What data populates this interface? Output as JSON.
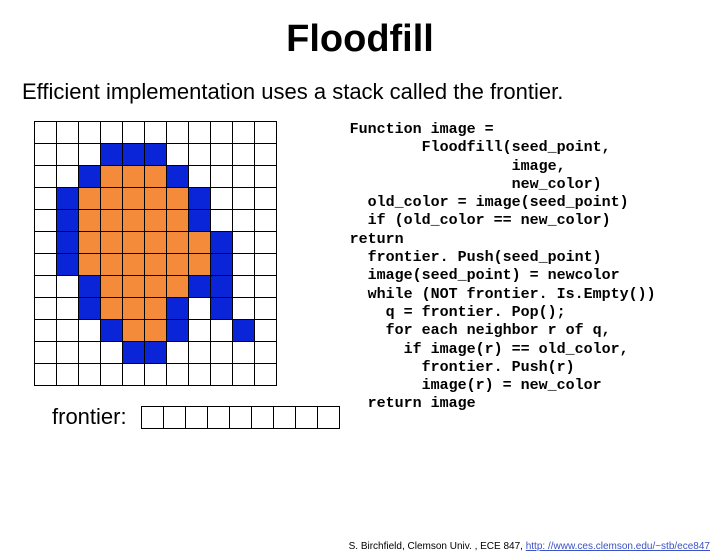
{
  "title": "Floodfill",
  "subtitle": "Efficient implementation uses a stack called the frontier.",
  "frontier_label": "frontier:",
  "code": {
    "l1": "Function image =",
    "l2": "        Floodfill(seed_point,",
    "l3": "                  image,",
    "l4": "                  new_color)",
    "l5": "  old_color = image(seed_point)",
    "l6": "  if (old_color == new_color)",
    "l7": "return",
    "l8": "  frontier. Push(seed_point)",
    "l9": "  image(seed_point) = newcolor",
    "l10": "  while (NOT frontier. Is.Empty())",
    "l11": "    q = frontier. Pop();",
    "l12": "    for each neighbor r of q,",
    "l13": "      if image(r) == old_color,",
    "l14": "        frontier. Push(r)",
    "l15": "        image(r) = new_color",
    "l16": "  return image"
  },
  "grid": [
    [
      "w",
      "w",
      "w",
      "w",
      "w",
      "w",
      "w",
      "w",
      "w",
      "w",
      "w"
    ],
    [
      "w",
      "w",
      "w",
      "b",
      "b",
      "b",
      "w",
      "w",
      "w",
      "w",
      "w"
    ],
    [
      "w",
      "w",
      "b",
      "o",
      "o",
      "o",
      "b",
      "w",
      "w",
      "w",
      "w"
    ],
    [
      "w",
      "b",
      "o",
      "o",
      "o",
      "o",
      "o",
      "b",
      "w",
      "w",
      "w"
    ],
    [
      "w",
      "b",
      "o",
      "o",
      "o",
      "o",
      "o",
      "b",
      "w",
      "w",
      "w"
    ],
    [
      "w",
      "b",
      "o",
      "o",
      "o",
      "o",
      "o",
      "o",
      "b",
      "w",
      "w"
    ],
    [
      "w",
      "b",
      "o",
      "o",
      "o",
      "o",
      "o",
      "o",
      "b",
      "w",
      "w"
    ],
    [
      "w",
      "w",
      "b",
      "o",
      "o",
      "o",
      "o",
      "b",
      "b",
      "w",
      "w"
    ],
    [
      "w",
      "w",
      "b",
      "o",
      "o",
      "o",
      "b",
      "w",
      "b",
      "w",
      "w"
    ],
    [
      "w",
      "w",
      "w",
      "b",
      "o",
      "o",
      "b",
      "w",
      "w",
      "b",
      "w"
    ],
    [
      "w",
      "w",
      "w",
      "w",
      "b",
      "b",
      "w",
      "w",
      "w",
      "w",
      "w"
    ],
    [
      "w",
      "w",
      "w",
      "w",
      "w",
      "w",
      "w",
      "w",
      "w",
      "w",
      "w"
    ]
  ],
  "stack_cells": 9,
  "footer": {
    "text": "S. Birchfield, Clemson Univ. , ECE 847, ",
    "link": "http: //www.ces.clemson.edu/~stb/ece847"
  }
}
